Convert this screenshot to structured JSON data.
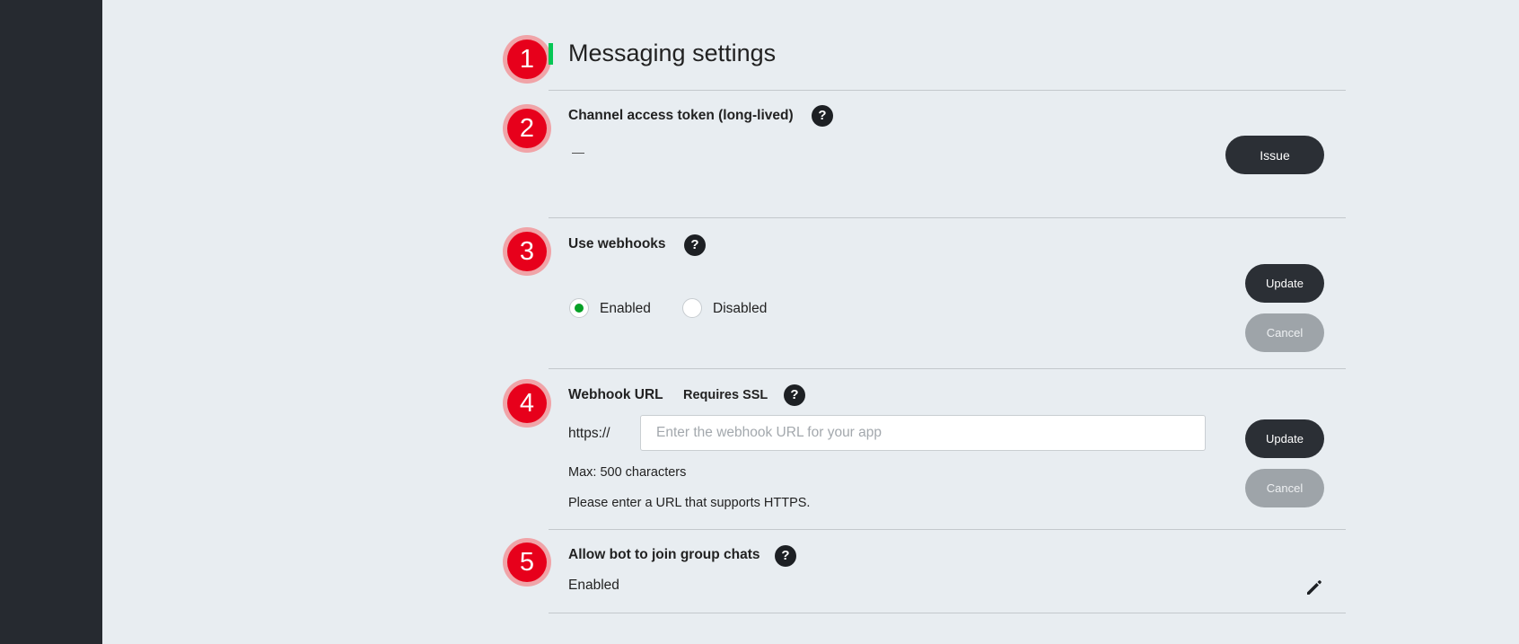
{
  "page": {
    "title": "Messaging settings"
  },
  "markers": [
    "1",
    "2",
    "3",
    "4",
    "5"
  ],
  "help_icon_glyph": "?",
  "colors": {
    "accent": "#06c755",
    "marker": "#e7001b",
    "sidebar": "#262a30",
    "radio_selected": "#06a026"
  },
  "channel_token": {
    "label": "Channel access token (long-lived)",
    "value": "—",
    "issue_label": "Issue"
  },
  "webhooks": {
    "label": "Use webhooks",
    "options": [
      {
        "label": "Enabled",
        "selected": true
      },
      {
        "label": "Disabled",
        "selected": false
      }
    ],
    "update_label": "Update",
    "cancel_label": "Cancel"
  },
  "webhook_url": {
    "label": "Webhook URL",
    "requires": "Requires SSL",
    "prefix": "https://",
    "value": "",
    "placeholder": "Enter the webhook URL for your app",
    "max_text": "Max: 500 characters",
    "hint": "Please enter a URL that supports HTTPS.",
    "update_label": "Update",
    "cancel_label": "Cancel"
  },
  "group_chats": {
    "label": "Allow bot to join group chats",
    "value": "Enabled",
    "edit_icon": "pencil-icon"
  }
}
